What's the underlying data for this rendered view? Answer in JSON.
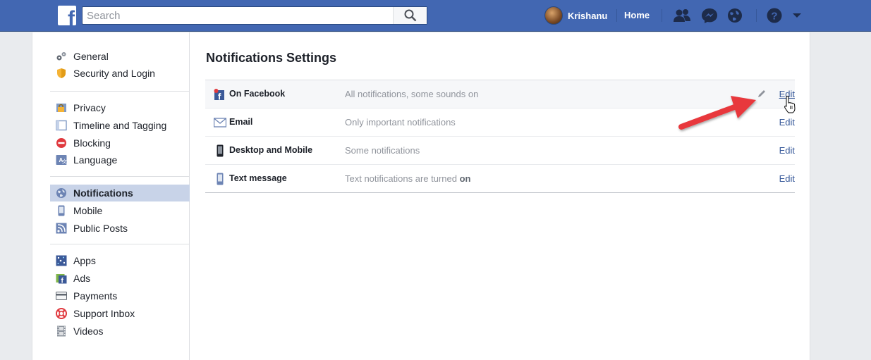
{
  "header": {
    "search_placeholder": "Search",
    "user_name": "Krishanu",
    "home_label": "Home",
    "icons": [
      "friend-requests-icon",
      "messenger-icon",
      "globe-notifications-icon",
      "help-icon",
      "account-menu-caret-icon"
    ]
  },
  "sidebar": {
    "groups": [
      [
        {
          "label": "General",
          "icon": "gears-icon"
        },
        {
          "label": "Security and Login",
          "icon": "shield-icon"
        }
      ],
      [
        {
          "label": "Privacy",
          "icon": "privacy-lock-icon"
        },
        {
          "label": "Timeline and Tagging",
          "icon": "timeline-icon"
        },
        {
          "label": "Blocking",
          "icon": "block-icon"
        },
        {
          "label": "Language",
          "icon": "language-icon"
        }
      ],
      [
        {
          "label": "Notifications",
          "icon": "globe-icon",
          "active": true
        },
        {
          "label": "Mobile",
          "icon": "mobile-icon"
        },
        {
          "label": "Public Posts",
          "icon": "rss-icon"
        }
      ],
      [
        {
          "label": "Apps",
          "icon": "apps-icon"
        },
        {
          "label": "Ads",
          "icon": "ads-icon"
        },
        {
          "label": "Payments",
          "icon": "card-icon"
        },
        {
          "label": "Support Inbox",
          "icon": "lifebuoy-icon"
        },
        {
          "label": "Videos",
          "icon": "film-icon"
        }
      ]
    ]
  },
  "main": {
    "title": "Notifications Settings",
    "rows": [
      {
        "label": "On Facebook",
        "value": "All notifications, some sounds on",
        "edit": "Edit",
        "icon": "facebook-notification-icon"
      },
      {
        "label": "Email",
        "value": "Only important notifications",
        "edit": "Edit",
        "icon": "envelope-icon"
      },
      {
        "label": "Desktop and Mobile",
        "value": "Some notifications",
        "edit": "Edit",
        "icon": "phone-icon"
      },
      {
        "label": "Text message",
        "value_prefix": "Text notifications are turned ",
        "value_strong": "on",
        "edit": "Edit",
        "icon": "sms-phone-icon"
      }
    ]
  },
  "colors": {
    "brand": "#4267b2",
    "link": "#365899",
    "annotation_arrow": "#e8393e"
  }
}
